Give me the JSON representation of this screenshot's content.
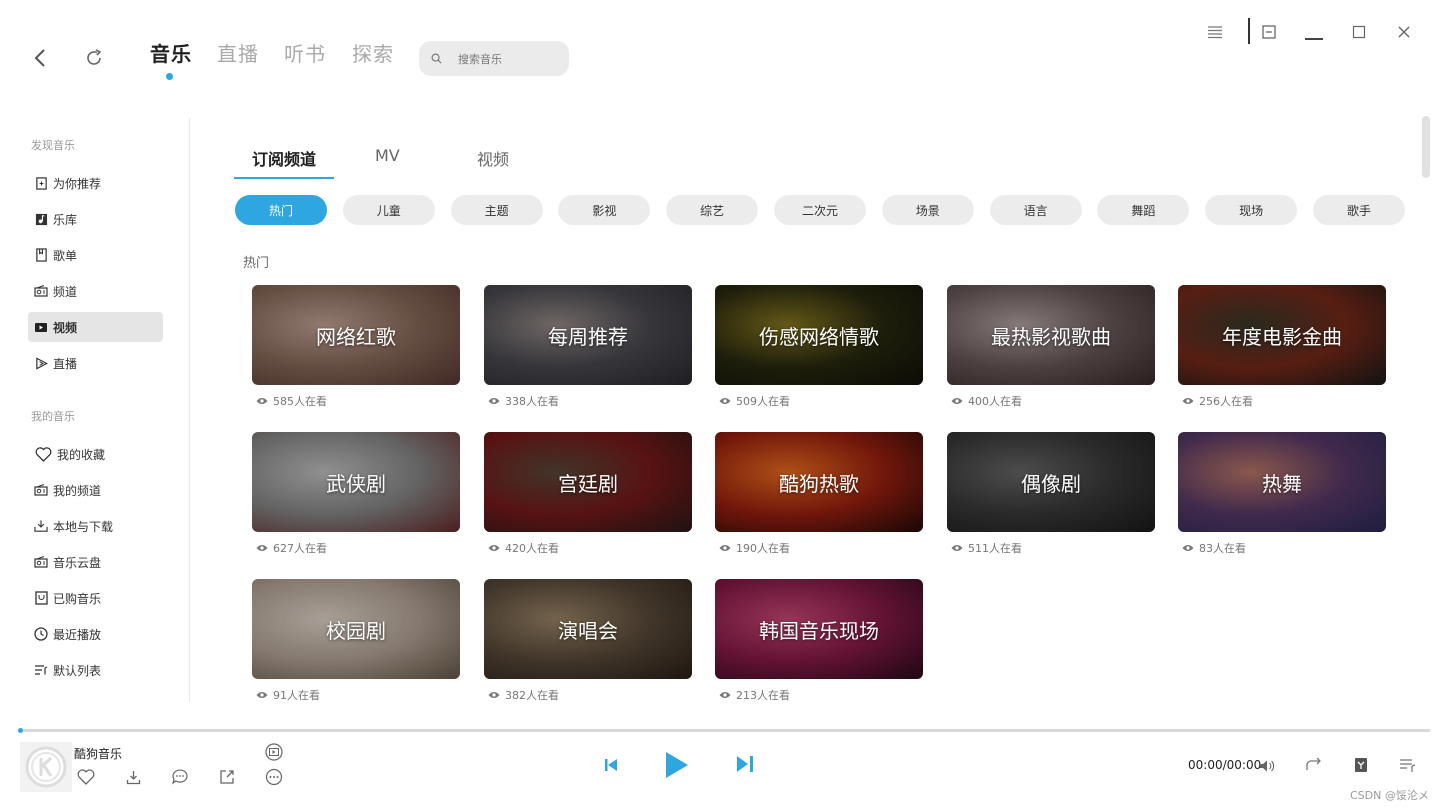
{
  "main_tabs": [
    {
      "label": "音乐",
      "active": true
    },
    {
      "label": "直播",
      "active": false
    },
    {
      "label": "听书",
      "active": false
    },
    {
      "label": "探索",
      "active": false
    }
  ],
  "search": {
    "placeholder": "搜索音乐"
  },
  "sidebar": {
    "discover_title": "发现音乐",
    "discover_items": [
      {
        "label": "为你推荐",
        "icon": "recommend-icon"
      },
      {
        "label": "乐库",
        "icon": "music-library-icon"
      },
      {
        "label": "歌单",
        "icon": "playlist-icon"
      },
      {
        "label": "频道",
        "icon": "radio-icon"
      },
      {
        "label": "视频",
        "icon": "video-icon",
        "active": true
      },
      {
        "label": "直播",
        "icon": "live-icon"
      }
    ],
    "my_title": "我的音乐",
    "my_items": [
      {
        "label": "我的收藏",
        "icon": "heart-icon"
      },
      {
        "label": "我的频道",
        "icon": "radio-icon"
      },
      {
        "label": "本地与下载",
        "icon": "download-icon"
      },
      {
        "label": "音乐云盘",
        "icon": "cloud-icon"
      },
      {
        "label": "已购音乐",
        "icon": "purchased-icon"
      },
      {
        "label": "最近播放",
        "icon": "clock-icon"
      },
      {
        "label": "默认列表",
        "icon": "list-icon"
      }
    ]
  },
  "sub_tabs": [
    {
      "label": "订阅频道",
      "active": true
    },
    {
      "label": "MV",
      "active": false
    },
    {
      "label": "视频",
      "active": false
    }
  ],
  "categories": [
    "热门",
    "儿童",
    "主题",
    "影视",
    "综艺",
    "二次元",
    "场景",
    "语言",
    "舞蹈",
    "现场",
    "歌手"
  ],
  "active_category": "热门",
  "section_label": "热门",
  "cards": [
    {
      "title": "网络红歌",
      "viewers": "585人在看",
      "tone": [
        "#8a6a5a",
        "#c9a89a",
        "#5a3a32"
      ]
    },
    {
      "title": "每周推荐",
      "viewers": "338人在看",
      "tone": [
        "#4a4a52",
        "#9a8e8a",
        "#2a2a30"
      ]
    },
    {
      "title": "伤感网络情歌",
      "viewers": "509人在看",
      "tone": [
        "#2a2a10",
        "#8a7a20",
        "#101008"
      ]
    },
    {
      "title": "最热影视歌曲",
      "viewers": "400人在看",
      "tone": [
        "#6a5a5a",
        "#b8a8a8",
        "#3a2a2a"
      ]
    },
    {
      "title": "年度电影金曲",
      "viewers": "256人在看",
      "tone": [
        "#7a2a1a",
        "#3a3a2a",
        "#1a1a1a"
      ]
    },
    {
      "title": "武侠剧",
      "viewers": "627人在看",
      "tone": [
        "#8a8a8a",
        "#c8c8c8",
        "#6a2a2a"
      ]
    },
    {
      "title": "宫廷剧",
      "viewers": "420人在看",
      "tone": [
        "#7a1a1a",
        "#5a4a3a",
        "#2a1a1a"
      ]
    },
    {
      "title": "酷狗热歌",
      "viewers": "190人在看",
      "tone": [
        "#a02010",
        "#f07020",
        "#200a08"
      ]
    },
    {
      "title": "偶像剧",
      "viewers": "511人在看",
      "tone": [
        "#3a3a3a",
        "#6a6a6a",
        "#1a1a1a"
      ]
    },
    {
      "title": "热舞",
      "viewers": "83人在看",
      "tone": [
        "#5a3a6a",
        "#c07a6a",
        "#2a2a5a"
      ]
    },
    {
      "title": "校园剧",
      "viewers": "91人在看",
      "tone": [
        "#b8a89a",
        "#e8dcd0",
        "#6a5a4a"
      ]
    },
    {
      "title": "演唱会",
      "viewers": "382人在看",
      "tone": [
        "#5a4a3a",
        "#a08a6a",
        "#2a2016"
      ]
    },
    {
      "title": "韩国音乐现场",
      "viewers": "213人在看",
      "tone": [
        "#8a1a4a",
        "#d04a7a",
        "#2a0a1a"
      ]
    }
  ],
  "player": {
    "song_name": "酷狗音乐",
    "time": "00:00/00:00",
    "progress": 0.0
  },
  "watermark": "CSDN @馁沦メ",
  "colors": {
    "accent": "#2ea7e0"
  }
}
